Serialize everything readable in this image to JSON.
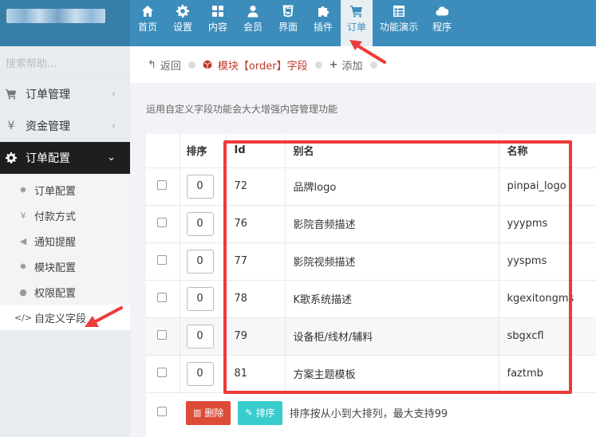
{
  "nav": [
    {
      "label": "首页",
      "icon": "home-icon"
    },
    {
      "label": "设置",
      "icon": "gear-icon"
    },
    {
      "label": "内容",
      "icon": "grid-icon"
    },
    {
      "label": "会员",
      "icon": "user-icon"
    },
    {
      "label": "界面",
      "icon": "html5-icon"
    },
    {
      "label": "插件",
      "icon": "puzzle-icon"
    },
    {
      "label": "订单",
      "icon": "cart-icon",
      "active": true
    },
    {
      "label": "功能演示",
      "icon": "table-icon"
    },
    {
      "label": "程序",
      "icon": "cloud-icon"
    }
  ],
  "sidebar": {
    "search_placeholder": "搜索帮助...",
    "menus": [
      {
        "label": "订单管理",
        "icon": "cart-icon"
      },
      {
        "label": "资金管理",
        "icon": "yen-icon"
      },
      {
        "label": "订单配置",
        "icon": "gear-icon",
        "active": true
      }
    ],
    "sub_items": [
      {
        "label": "订单配置",
        "icon": "gear-icon"
      },
      {
        "label": "付款方式",
        "icon": "yen-icon"
      },
      {
        "label": "通知提醒",
        "icon": "bullhorn-icon"
      },
      {
        "label": "模块配置",
        "icon": "gear-icon"
      },
      {
        "label": "权限配置",
        "icon": "users-icon"
      },
      {
        "label": "自定义字段",
        "icon": "code-icon",
        "active": true
      }
    ]
  },
  "breadcrumb": {
    "back": "返回",
    "current": "模块【order】字段",
    "add": "添加"
  },
  "description": "运用自定义字段功能会大大增强内容管理功能",
  "table": {
    "headers": {
      "order": "排序",
      "id": "Id",
      "alias": "别名",
      "name": "名称"
    },
    "rows": [
      {
        "order": "0",
        "id": "72",
        "alias": "品牌logo",
        "name": "pinpai_logo"
      },
      {
        "order": "0",
        "id": "76",
        "alias": "影院音频描述",
        "name": "yyypms"
      },
      {
        "order": "0",
        "id": "77",
        "alias": "影院视频描述",
        "name": "yyspms"
      },
      {
        "order": "0",
        "id": "78",
        "alias": "K歌系统描述",
        "name": "kgexitongms"
      },
      {
        "order": "0",
        "id": "79",
        "alias": "设备柜/线材/辅料",
        "name": "sbgxcfl"
      },
      {
        "order": "0",
        "id": "81",
        "alias": "方案主题模板",
        "name": "faztmb"
      }
    ]
  },
  "footer": {
    "delete_label": "删除",
    "sort_label": "排序",
    "hint": "排序按从小到大排列，最大支持99"
  },
  "colors": {
    "topbar": "#3c8dbc",
    "highlight": "#ee3a3a",
    "delete": "#dd4b39",
    "sort": "#39cccc"
  }
}
